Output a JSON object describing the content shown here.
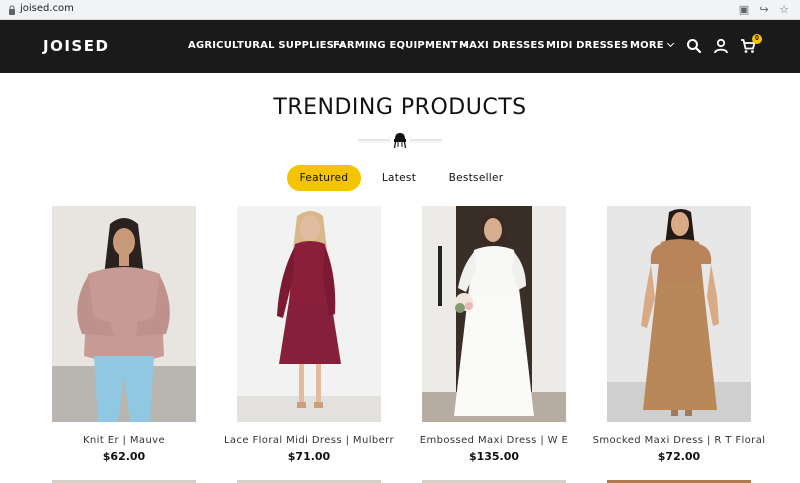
{
  "browser": {
    "url": "joised.com",
    "translate_icon": "translate-icon",
    "share_icon": "share-icon",
    "star_icon": "star-icon"
  },
  "header": {
    "logo": "JOISED",
    "nav": [
      {
        "label": "AGRICULTURAL SUPPLIES",
        "has_dropdown": true
      },
      {
        "label": "FARMING EQUIPMENT",
        "has_dropdown": true
      },
      {
        "label": "MAXI DRESSES",
        "has_dropdown": false
      },
      {
        "label": "MIDI DRESSES",
        "has_dropdown": false
      },
      {
        "label": "MORE",
        "has_dropdown": true
      }
    ],
    "cart_count": "0",
    "icons": [
      "search-icon",
      "account-icon",
      "cart-icon"
    ]
  },
  "section": {
    "title": "TRENDING PRODUCTS",
    "tabs": [
      {
        "label": "Featured",
        "active": true
      },
      {
        "label": "Latest",
        "active": false
      },
      {
        "label": "Bestseller",
        "active": false
      }
    ]
  },
  "products": [
    {
      "name": "Knit Er | Mauve",
      "price": "$62.00"
    },
    {
      "name": "Lace Floral Midi Dress | Mulberr",
      "price": "$71.00"
    },
    {
      "name": "Embossed Maxi Dress | W E",
      "price": "$135.00"
    },
    {
      "name": "Smocked Maxi Dress | R T Floral",
      "price": "$72.00"
    }
  ],
  "colors": {
    "header_bg": "#1a1a1a",
    "accent": "#f5c400",
    "text": "#111111"
  }
}
